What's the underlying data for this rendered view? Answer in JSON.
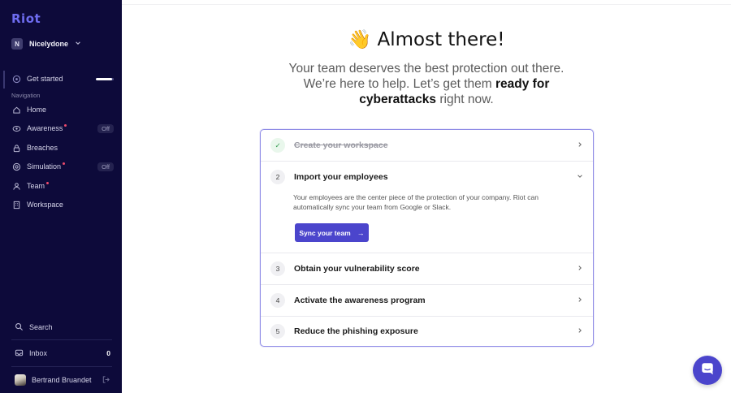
{
  "colors": {
    "sidebar_bg": "#0d0a3a",
    "accent": "#4b45cc",
    "notification_dot": "#ef4a6c",
    "card_border": "#8f8ce6"
  },
  "sidebar": {
    "logo": "Riot",
    "org": {
      "initial": "N",
      "name": "Nicelydone",
      "icon": "chevron-down-icon"
    },
    "get_started": {
      "label": "Get started",
      "icon": "gauge-icon",
      "progress": 0.9
    },
    "nav_heading": "Navigation",
    "items": [
      {
        "label": "Home",
        "icon": "home-icon",
        "dot": false,
        "badge": ""
      },
      {
        "label": "Awareness",
        "icon": "eye-icon",
        "dot": true,
        "badge": "Off"
      },
      {
        "label": "Breaches",
        "icon": "lock-icon",
        "dot": false,
        "badge": ""
      },
      {
        "label": "Simulation",
        "icon": "target-icon",
        "dot": true,
        "badge": "Off"
      },
      {
        "label": "Team",
        "icon": "users-icon",
        "dot": true,
        "badge": ""
      },
      {
        "label": "Workspace",
        "icon": "building-icon",
        "dot": false,
        "badge": ""
      }
    ],
    "search": {
      "label": "Search",
      "icon": "search-icon"
    },
    "inbox": {
      "label": "Inbox",
      "count": "0",
      "icon": "inbox-icon"
    },
    "user": {
      "name": "Bertrand Bruandet",
      "icon": "logout-icon"
    }
  },
  "hero": {
    "emoji": "👋",
    "title": "Almost there!",
    "subtitle_part1": "Your team deserves the best protection out there. We’re here to help. Let’s get them ",
    "subtitle_bold": "ready for cyberattacks",
    "subtitle_part2": " right now."
  },
  "steps": [
    {
      "number": "✓",
      "label": "Create your workspace",
      "done": true,
      "chevron": "chevron-right-icon"
    },
    {
      "number": "2",
      "label": "Import your employees",
      "done": false,
      "expanded": true,
      "chevron": "chevron-down-icon",
      "description": "Your employees are the center piece of the protection of your company. Riot can automatically sync your team from Google or Slack.",
      "button_label": "Sync your team",
      "button_icon": "arrow-right-icon"
    },
    {
      "number": "3",
      "label": "Obtain your vulnerability score",
      "done": false,
      "chevron": "chevron-right-icon"
    },
    {
      "number": "4",
      "label": "Activate the awareness program",
      "done": false,
      "chevron": "chevron-right-icon"
    },
    {
      "number": "5",
      "label": "Reduce the phishing exposure",
      "done": false,
      "chevron": "chevron-right-icon"
    }
  ],
  "chat": {
    "icon": "chat-icon"
  }
}
